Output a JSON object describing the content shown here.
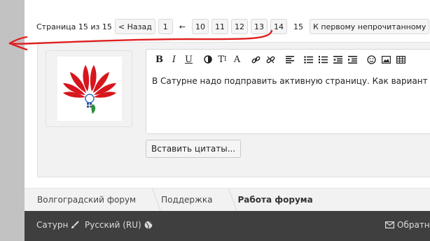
{
  "pagination": {
    "label": "Страница 15 из 15",
    "prev": "< Назад",
    "pages": [
      "1",
      "←",
      "10",
      "11",
      "12",
      "13",
      "14"
    ],
    "current": "15",
    "first_unread": "К первому непрочитанному"
  },
  "editor": {
    "toolbar": [
      "bold-icon",
      "italic-icon",
      "underline-icon",
      "color-icon",
      "font-size-icon",
      "font-icon",
      "link-icon",
      "unlink-icon",
      "align-icon",
      "bullet-list-icon",
      "number-list-icon",
      "outdent-icon",
      "indent-icon",
      "smiley-icon",
      "image-icon",
      "table-icon"
    ],
    "text": "В Сатурне надо подправить активную страницу. Как вариант сдел"
  },
  "insert_quotes": "Вставить цитаты...",
  "breadcrumb": [
    "Волгоградский форум",
    "Поддержка",
    "Работа форума"
  ],
  "footer": {
    "style": "Сатурн",
    "language": "Русский (RU)",
    "contact": "Обратна"
  },
  "colors": {
    "annotation": "#e02020",
    "footer_bg": "#3f3f3f",
    "gutter": "#c2c2c2"
  }
}
